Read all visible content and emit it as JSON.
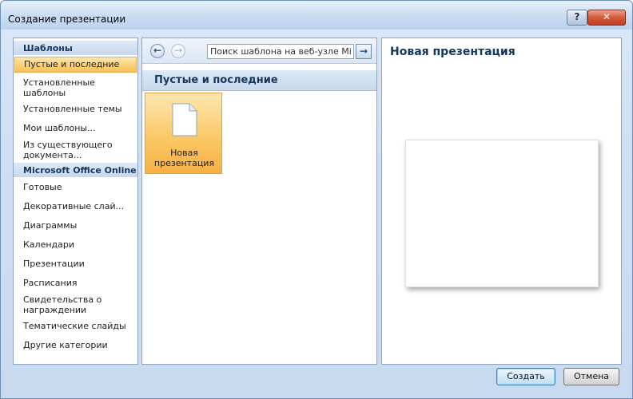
{
  "window": {
    "title": "Создание презентации"
  },
  "titlebar": {
    "help_label": "?",
    "close_label": "✕"
  },
  "sidebar": {
    "section_templates": "Шаблоны",
    "items_templates": [
      {
        "label": "Пустые и последние",
        "selected": true
      },
      {
        "label": "Установленные шаблоны",
        "lines": [
          "Установленные",
          "шаблоны"
        ]
      },
      {
        "label": "Установленные темы"
      },
      {
        "label": "Мои шаблоны..."
      },
      {
        "label": "Из существующего документа...",
        "lines": [
          "Из существующего",
          "документа..."
        ]
      }
    ],
    "section_online": "Microsoft Office Online",
    "items_online": [
      {
        "label": "Готовые"
      },
      {
        "label": "Декоративные слай..."
      },
      {
        "label": "Диаграммы"
      },
      {
        "label": "Календари"
      },
      {
        "label": "Презентации"
      },
      {
        "label": "Расписания"
      },
      {
        "label": "Свидетельства о награждении",
        "lines": [
          "Свидетельства о",
          "награждении"
        ]
      },
      {
        "label": "Тематические слайды"
      },
      {
        "label": "Другие категории"
      }
    ]
  },
  "toolbar": {
    "back_icon": "←",
    "forward_icon": "→",
    "search_placeholder": "Поиск шаблона на веб-узле Microsoft Office Online",
    "search_visible": "Поиск шаблона на веб-узле Micro",
    "go_icon": "→"
  },
  "middle": {
    "heading": "Пустые и последние",
    "tile": {
      "label_line1": "Новая",
      "label_line2": "презентация"
    }
  },
  "preview": {
    "title": "Новая презентация"
  },
  "buttons": {
    "create": "Создать",
    "cancel": "Отмена"
  },
  "colors": {
    "accent_selected": "#fbd27a",
    "heading_text": "#14365f",
    "close_button": "#c03e22"
  }
}
